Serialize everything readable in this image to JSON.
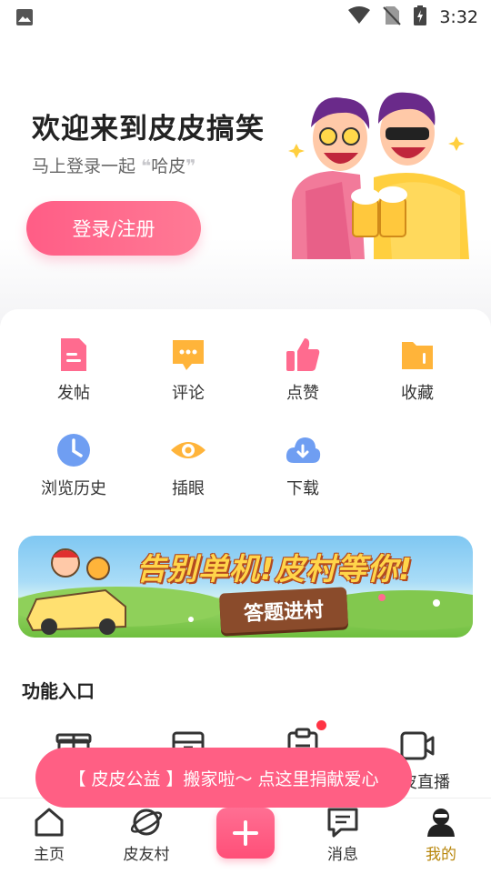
{
  "status_bar": {
    "time": "3:32"
  },
  "header": {
    "welcome": "欢迎来到皮皮搞笑",
    "subtitle_prefix": "马上登录一起",
    "subtitle_quote_open": "❝",
    "subtitle_highlight": "哈皮",
    "subtitle_quote_close": "❞",
    "login_button": "登录/注册"
  },
  "activity_grid": [
    {
      "label": "发帖",
      "icon": "post-icon"
    },
    {
      "label": "评论",
      "icon": "comment-icon"
    },
    {
      "label": "点赞",
      "icon": "like-icon"
    },
    {
      "label": "收藏",
      "icon": "folder-icon"
    },
    {
      "label": "浏览历史",
      "icon": "clock-icon"
    },
    {
      "label": "插眼",
      "icon": "eye-icon"
    },
    {
      "label": "下载",
      "icon": "download-cloud-icon"
    }
  ],
  "banner": {
    "headline": "告别单机!皮村等你!",
    "sign": "答题进村"
  },
  "features": {
    "title": "功能入口",
    "items": [
      {
        "label": "",
        "icon": "gift-icon"
      },
      {
        "label": "",
        "icon": "box-icon"
      },
      {
        "label": "",
        "icon": "clipboard-icon",
        "badge": true
      },
      {
        "label": "皮皮直播",
        "icon": "video-camera-icon"
      }
    ]
  },
  "toast": {
    "text": "【 皮皮公益 】搬家啦～ 点这里捐献爱心"
  },
  "tabbar": {
    "items": [
      {
        "label": "主页",
        "icon": "home-icon"
      },
      {
        "label": "皮友村",
        "icon": "planet-icon"
      },
      {
        "label": "",
        "icon": "plus-icon"
      },
      {
        "label": "消息",
        "icon": "message-icon"
      },
      {
        "label": "我的",
        "icon": "profile-icon",
        "active": true
      }
    ]
  },
  "colors": {
    "accent": "#ff5d86",
    "active_tab": "#b8860b"
  }
}
